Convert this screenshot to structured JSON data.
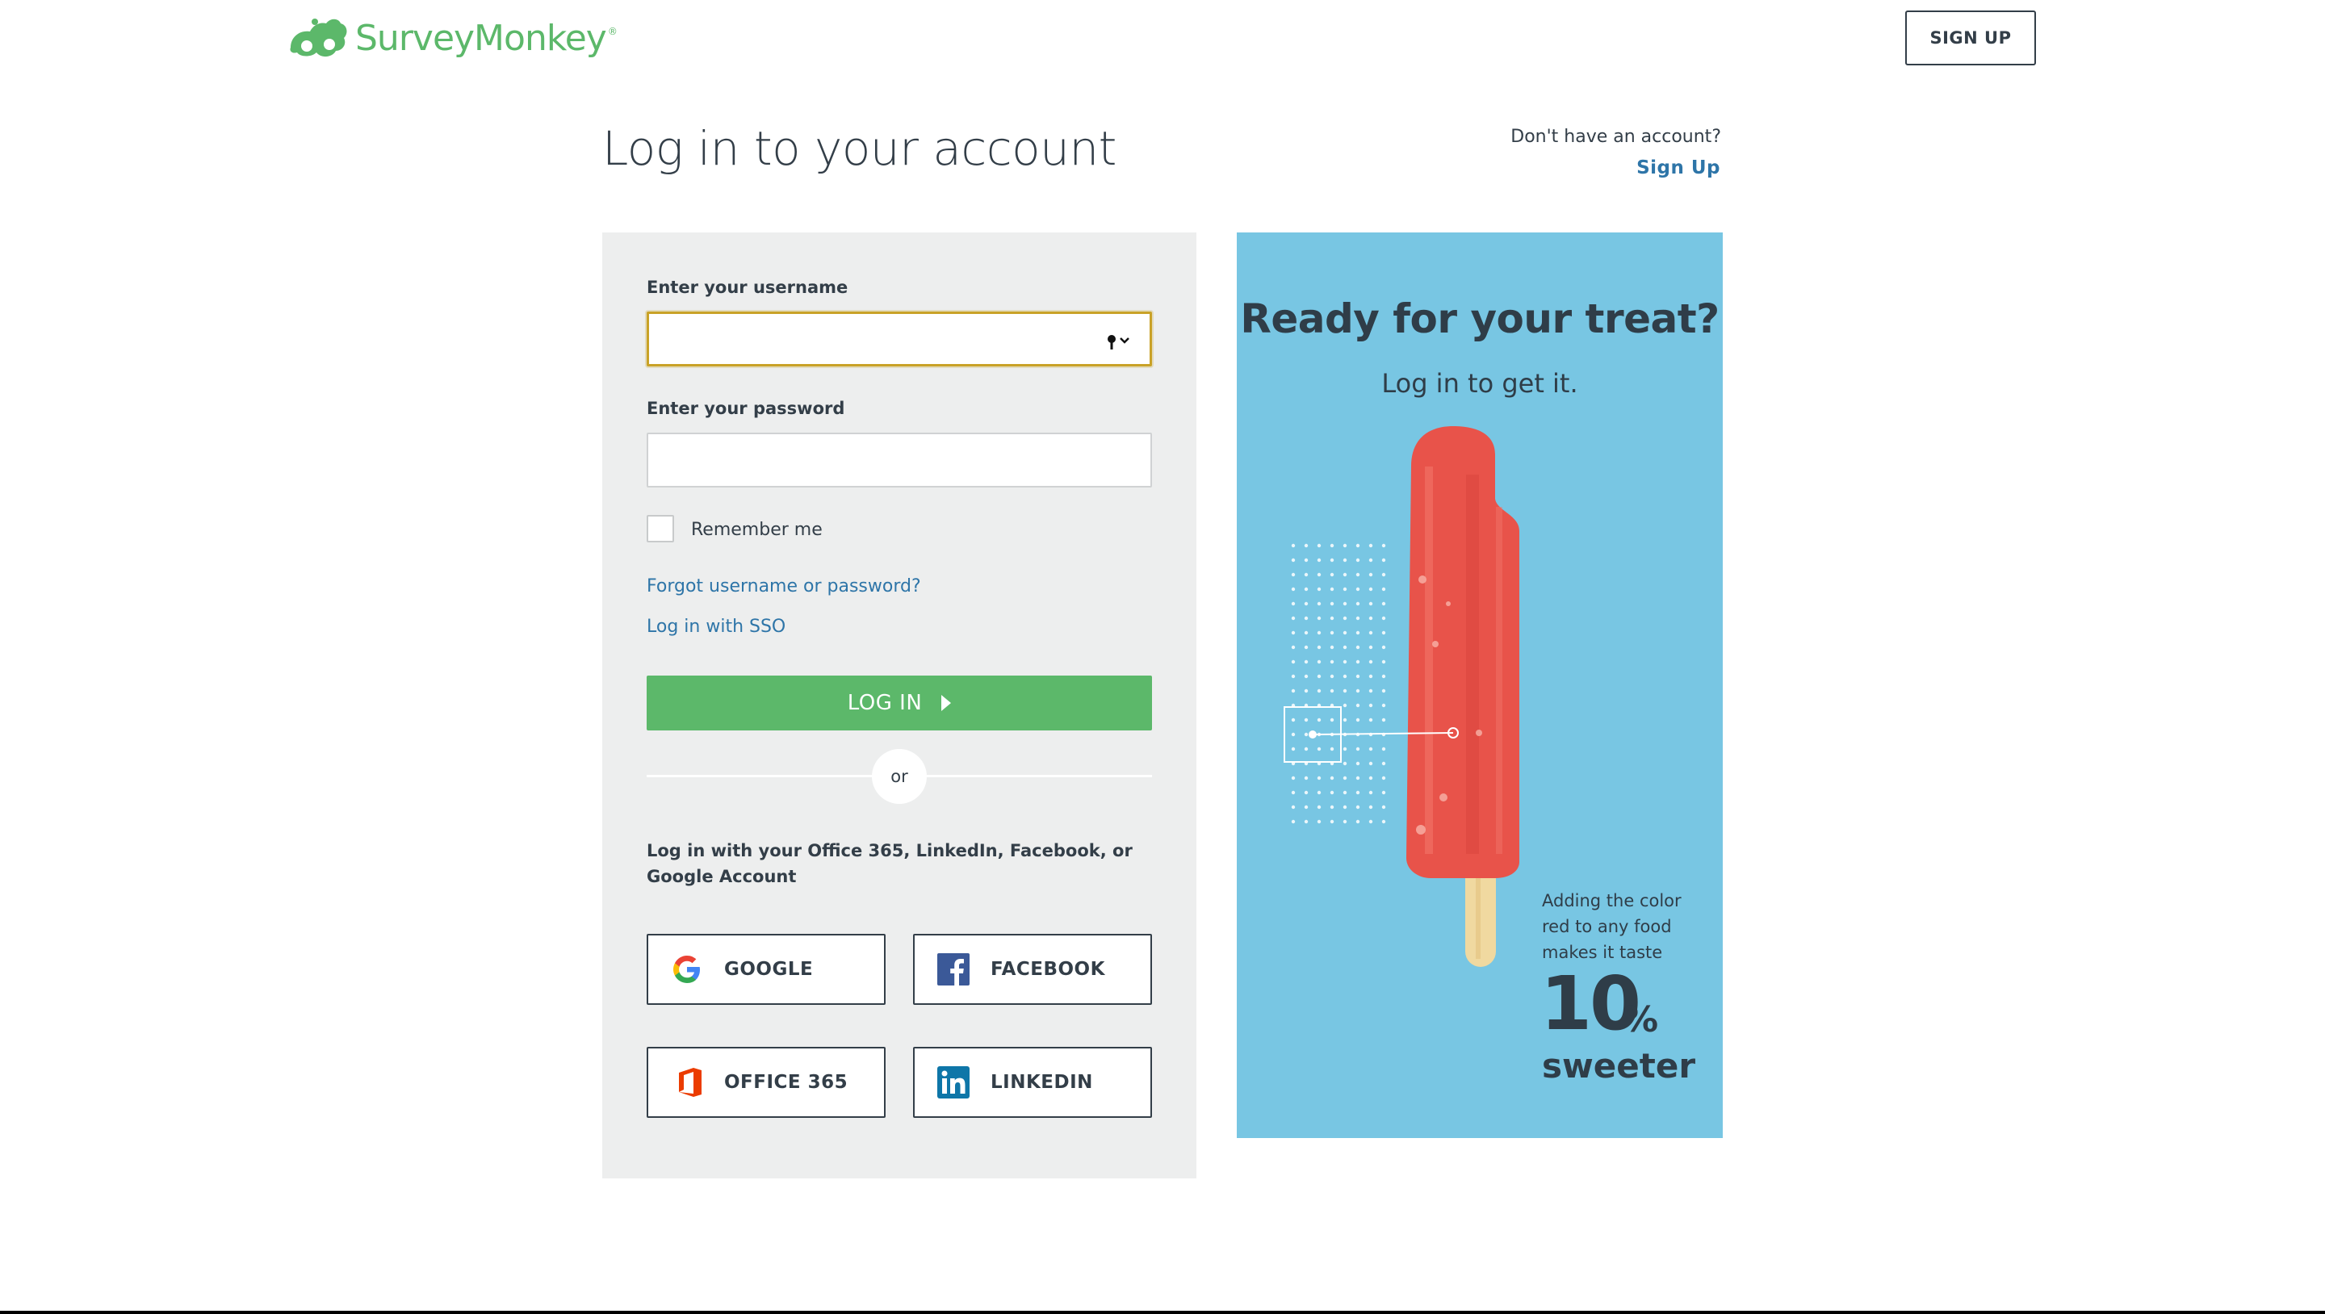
{
  "brand": {
    "name": "SurveyMonkey",
    "registered": "®",
    "color": "#5cb86a"
  },
  "header": {
    "signup_label": "SIGN UP"
  },
  "title": "Log in to your account",
  "account_prompt": {
    "text": "Don't have an account?",
    "link": "Sign Up"
  },
  "form": {
    "username_label": "Enter your username",
    "username_value": "",
    "password_label": "Enter your password",
    "password_value": "",
    "remember_label": "Remember me",
    "remember_checked": false,
    "forgot_link": "Forgot username or password?",
    "sso_link": "Log in with SSO",
    "login_label": "LOG IN",
    "divider_text": "or",
    "social_text": "Log in with your Office 365, LinkedIn, Facebook, or Google Account",
    "social_buttons": [
      {
        "label": "GOOGLE",
        "icon": "google-icon"
      },
      {
        "label": "FACEBOOK",
        "icon": "facebook-icon"
      },
      {
        "label": "OFFICE 365",
        "icon": "office365-icon"
      },
      {
        "label": "LINKEDIN",
        "icon": "linkedin-icon"
      }
    ]
  },
  "promo": {
    "title": "Ready for your treat?",
    "subtitle": "Log in to get it.",
    "fact_text": "Adding the color red to any food makes it taste",
    "fact_number": "10",
    "fact_percent": "%",
    "fact_word": "sweeter",
    "background": "#78c6e3",
    "popsicle_color": "#e8534a"
  },
  "colors": {
    "accent_green": "#5cb86a",
    "link_blue": "#2e75a8",
    "text_dark": "#333e48",
    "panel_gray": "#edeeee"
  }
}
